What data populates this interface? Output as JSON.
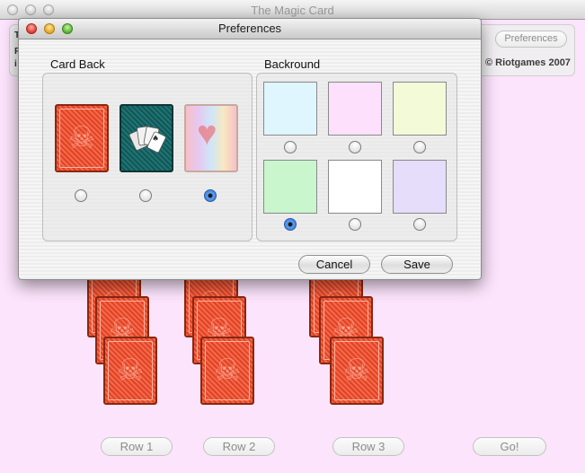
{
  "main_window": {
    "title": "The Magic Card",
    "preferences_button": "Preferences",
    "credit": "© Riotgames 2007",
    "panel_fragment_1": "T",
    "panel_fragment_2": "F",
    "panel_fragment_3": "i"
  },
  "bottom_buttons": {
    "row1": "Row 1",
    "row2": "Row 2",
    "row3": "Row 3",
    "go": "Go!"
  },
  "dialog": {
    "title": "Preferences",
    "card_back_label": "Card Back",
    "background_label": "Backround",
    "cancel_label": "Cancel",
    "save_label": "Save",
    "card_backs": [
      {
        "name": "skull",
        "selected": false
      },
      {
        "name": "playing-cards",
        "selected": false
      },
      {
        "name": "heart",
        "selected": true
      }
    ],
    "backgrounds": [
      {
        "color": "#dff6ff",
        "selected": false
      },
      {
        "color": "#fde0fc",
        "selected": false
      },
      {
        "color": "#f3fad8",
        "selected": false
      },
      {
        "color": "#c9f6cc",
        "selected": true
      },
      {
        "color": "#ffffff",
        "selected": false
      },
      {
        "color": "#e6ddfb",
        "selected": false
      }
    ]
  },
  "colors": {
    "background": "#fce4fc",
    "card_red": "#e24226",
    "card_teal": "#1b6a6a"
  }
}
